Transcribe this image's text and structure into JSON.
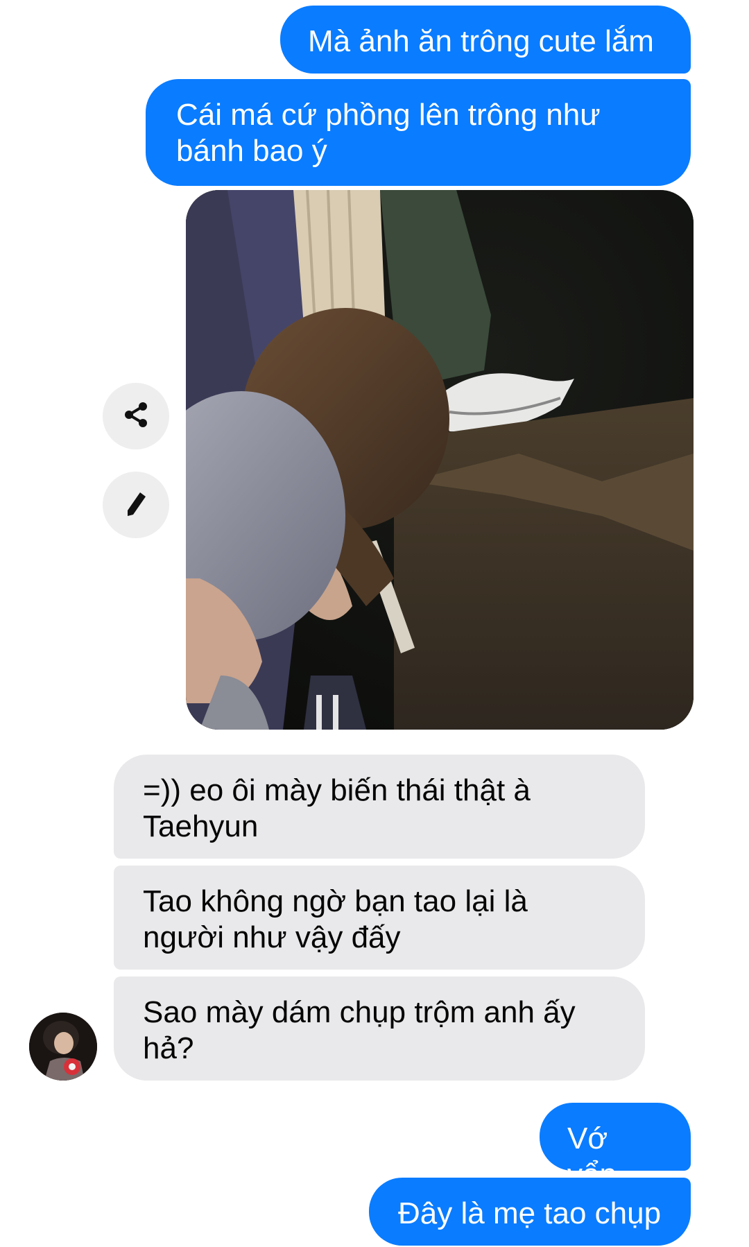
{
  "messages": {
    "out_1": "Mà ảnh ăn trông cute lắm",
    "out_2": "Cái má cứ phồng lên trông như bánh bao ý",
    "in_1": "=)) eo ôi mày biến thái thật à Taehyun",
    "in_2": "Tao không ngờ bạn tao lại là người như vậy đấy",
    "in_3": "Sao mày dám chụp trộm anh ấy hả?",
    "out_3": "Vớ vẩn",
    "out_4": "Đây là mẹ tao chụp"
  },
  "actions": {
    "share_icon": "share-icon",
    "edit_icon": "pencil-icon"
  },
  "colors": {
    "outgoing_bubble": "#0a7cff",
    "incoming_bubble": "#e9e9eb"
  }
}
